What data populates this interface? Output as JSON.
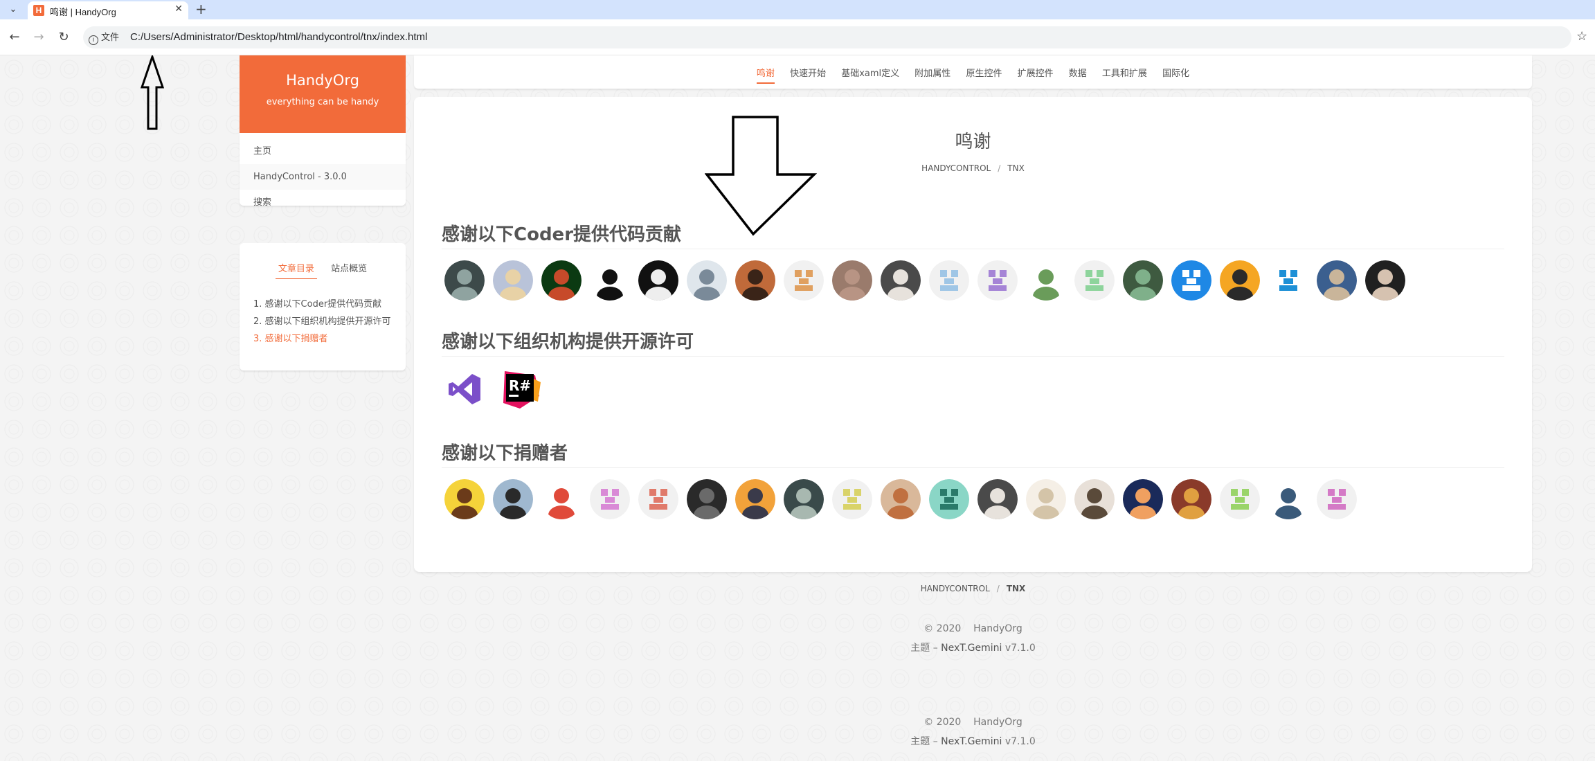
{
  "browser": {
    "tab_title": "鸣谢 | HandyOrg",
    "tab_favicon_letter": "H",
    "site_info_label": "文件",
    "url": "C:/Users/Administrator/Desktop/html/handycontrol/tnx/index.html",
    "menu_glyph": "⌄",
    "close_glyph": "✕",
    "new_tab_glyph": "+",
    "back_glyph": "←",
    "forward_glyph": "→",
    "reload_glyph": "↻",
    "star_glyph": "☆"
  },
  "brand": {
    "title": "HandyOrg",
    "subtitle": "everything can be handy",
    "color": "#f26b3a"
  },
  "site_menu": [
    {
      "label": "主页",
      "active": false
    },
    {
      "label": "HandyControl - 3.0.0",
      "active": true
    },
    {
      "label": "搜索",
      "active": false
    }
  ],
  "toc": {
    "tabs": [
      "文章目录",
      "站点概览"
    ],
    "items": [
      "1. 感谢以下Coder提供代码贡献",
      "2. 感谢以下组织机构提供开源许可",
      "3. 感谢以下捐赠者"
    ]
  },
  "top_nav": [
    "鸣谢",
    "快速开始",
    "基础xaml定义",
    "附加属性",
    "原生控件",
    "扩展控件",
    "数据",
    "工具和扩展",
    "国际化"
  ],
  "post": {
    "title": "鸣谢",
    "breadcrumb": [
      "HANDYCONTROL",
      "TNX"
    ],
    "sections": [
      {
        "heading": "感谢以下Coder提供代码贡献"
      },
      {
        "heading": "感谢以下组织机构提供开源许可"
      },
      {
        "heading": "感谢以下捐赠者"
      }
    ],
    "orgs": [
      {
        "icon": "visual-studio-logo-icon",
        "color": "#7b4fc9"
      },
      {
        "icon": "resharper-logo-icon",
        "text": "R#",
        "color": "#e3125f"
      }
    ]
  },
  "footer": {
    "breadcrumb": [
      "HANDYCONTROL",
      "TNX"
    ],
    "copyright_year": "© 2020",
    "copyright_owner": "HandyOrg",
    "theme_prefix": "主题 –",
    "theme_name": "NexT.Gemini",
    "theme_version": "v7.1.0"
  },
  "colors": {
    "accent": "#f26b3a",
    "text": "#555555"
  }
}
